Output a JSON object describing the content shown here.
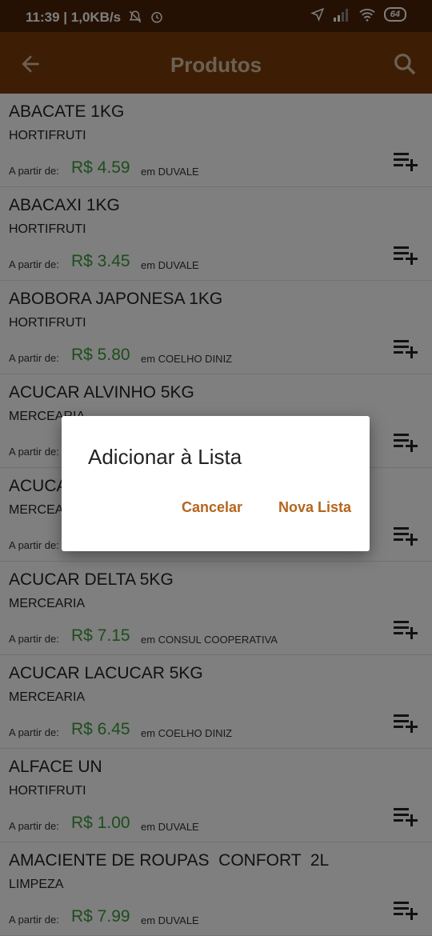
{
  "status_bar": {
    "time": "11:39",
    "speed": "| 1,0KB/s",
    "battery": "64"
  },
  "app_bar": {
    "title": "Produtos",
    "back_icon": "arrow-back-icon",
    "search_icon": "search-icon",
    "color": "#7a3c0a",
    "title_color": "#d9c2a6"
  },
  "products": [
    {
      "name": "ABACATE 1KG",
      "category": "HORTIFRUTI",
      "from_label": "A partir de:",
      "price": "R$ 4.59",
      "store": "em DUVALE"
    },
    {
      "name": "ABACAXI 1KG",
      "category": "HORTIFRUTI",
      "from_label": "A partir de:",
      "price": "R$ 3.45",
      "store": "em DUVALE"
    },
    {
      "name": "ABOBORA JAPONESA 1KG",
      "category": "HORTIFRUTI",
      "from_label": "A partir de:",
      "price": "R$ 5.80",
      "store": "em COELHO DINIZ"
    },
    {
      "name": "ACUCAR ALVINHO 5KG",
      "category": "MERCEARIA",
      "from_label": "A partir de:",
      "price": "",
      "store": ""
    },
    {
      "name": "ACUCA",
      "category": "MERCEA",
      "from_label": "A partir de:",
      "price": "",
      "store": ""
    },
    {
      "name": "ACUCAR DELTA 5KG",
      "category": "MERCEARIA",
      "from_label": "A partir de:",
      "price": "R$ 7.15",
      "store": "em CONSUL COOPERATIVA"
    },
    {
      "name": "ACUCAR LACUCAR 5KG",
      "category": "MERCEARIA",
      "from_label": "A partir de:",
      "price": "R$ 6.45",
      "store": "em COELHO DINIZ"
    },
    {
      "name": "ALFACE UN",
      "category": "HORTIFRUTI",
      "from_label": "A partir de:",
      "price": "R$ 1.00",
      "store": "em DUVALE"
    },
    {
      "name": "AMACIENTE DE ROUPAS  CONFORT  2L",
      "category": "LIMPEZA",
      "from_label": "A partir de:",
      "price": "R$ 7.99",
      "store": "em DUVALE"
    }
  ],
  "dialog": {
    "title": "Adicionar à Lista",
    "cancel_label": "Cancelar",
    "new_list_label": "Nova Lista",
    "button_color": "#b5651d"
  },
  "price_color": "#3a9b3a"
}
